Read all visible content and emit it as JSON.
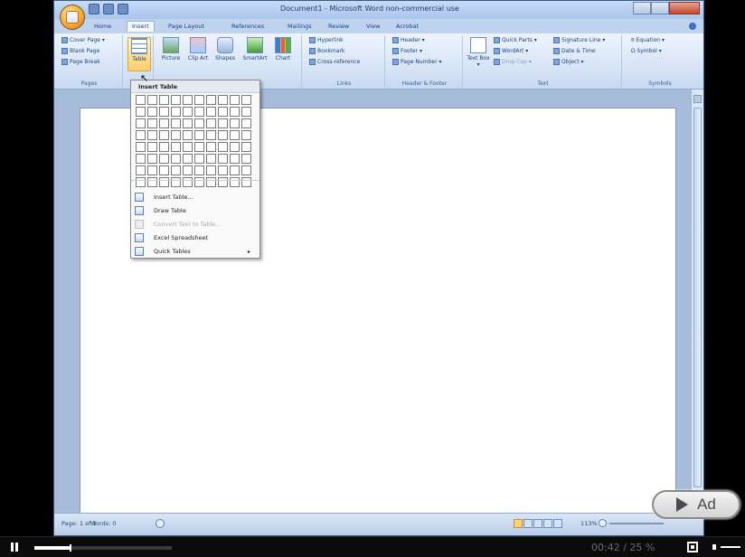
{
  "window": {
    "title": "Document1 - Microsoft Word non-commercial use",
    "tabs": [
      "Home",
      "Insert",
      "Page Layout",
      "References",
      "Mailings",
      "Review",
      "View",
      "Acrobat"
    ],
    "active_tab": "Insert"
  },
  "ribbon": {
    "pages": {
      "cover_page": "Cover Page ▾",
      "blank_page": "Blank Page",
      "page_break": "Page Break",
      "label": "Pages"
    },
    "tables": {
      "table": "Table"
    },
    "illustrations": {
      "picture": "Picture",
      "clip_art": "Clip Art",
      "shapes": "Shapes",
      "smartart": "SmartArt",
      "chart": "Chart"
    },
    "links": {
      "hyperlink": "Hyperlink",
      "bookmark": "Bookmark",
      "cross_reference": "Cross-reference",
      "label": "Links"
    },
    "header_footer": {
      "header": "Header ▾",
      "footer": "Footer ▾",
      "page_number": "Page Number ▾",
      "label": "Header & Footer"
    },
    "text": {
      "text_box": "Text Box ▾",
      "quick_parts": "Quick Parts ▾",
      "wordart": "WordArt ▾",
      "drop_cap": "Drop Cap ▾",
      "signature_line": "Signature Line ▾",
      "date_time": "Date & Time",
      "object": "Object ▾",
      "label": "Text"
    },
    "symbols": {
      "equation": "π Equation ▾",
      "symbol": "Ω Symbol ▾",
      "label": "Symbols"
    }
  },
  "table_menu": {
    "header": "Insert Table",
    "grid_columns": 10,
    "grid_rows": 8,
    "items": [
      {
        "label": "Insert Table...",
        "enabled": true,
        "icon": "insert-table-icon"
      },
      {
        "label": "Draw Table",
        "enabled": true,
        "icon": "draw-table-icon"
      },
      {
        "label": "Convert Text to Table...",
        "enabled": false,
        "icon": "convert-text-icon"
      },
      {
        "label": "Excel Spreadsheet",
        "enabled": true,
        "icon": "excel-icon"
      },
      {
        "label": "Quick Tables",
        "enabled": true,
        "icon": "quick-tables-icon",
        "submenu": true
      }
    ],
    "submenu_arrow": "▸"
  },
  "status": {
    "page": "Page: 1 of 1",
    "words": "Words: 0",
    "zoom": "113%"
  },
  "player": {
    "time": "00:42 / 25 %",
    "progress": 0.26,
    "ad_label": "Ad",
    "colors": {
      "background": "#000000",
      "timeline_fill": "#ffffff",
      "timeline_track": "#3a3a3a"
    }
  }
}
